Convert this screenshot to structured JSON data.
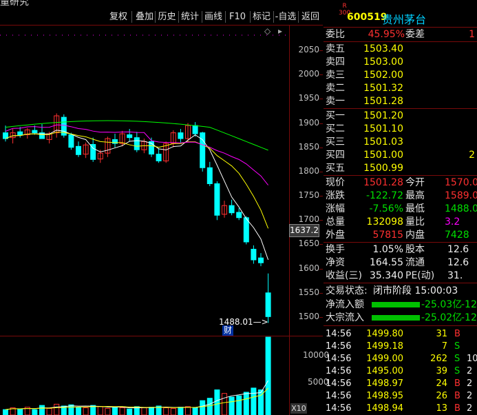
{
  "header": {
    "title_fragment": "量研究"
  },
  "toolbar": {
    "buttons": [
      "复权",
      "叠加",
      "历史",
      "统计",
      "画线",
      "F10",
      "标记",
      "-自选",
      "返回"
    ]
  },
  "chart": {
    "price_axis": [
      "2050",
      "2000",
      "1950",
      "1900",
      "1850",
      "1800",
      "1750",
      "1700",
      "1650",
      "1600",
      "1550",
      "1500"
    ],
    "current_price_tag": "1637.2",
    "low_annotation": "1488.01",
    "finance_marker": "财",
    "volume_axis": [
      "10000",
      "5000"
    ],
    "volume_unit": "X10",
    "colors": {
      "up": "#ff3030",
      "down": "#00ffff",
      "ma5": "#ffffff",
      "ma10": "#ffff00",
      "ma20": "#ff00ff",
      "ma60": "#00ff00"
    }
  },
  "chart_data": {
    "type": "candlestick",
    "candles": [
      {
        "o": 1880,
        "h": 1895,
        "l": 1862,
        "c": 1868
      },
      {
        "o": 1870,
        "h": 1888,
        "l": 1858,
        "c": 1880
      },
      {
        "o": 1882,
        "h": 1892,
        "l": 1870,
        "c": 1875
      },
      {
        "o": 1876,
        "h": 1890,
        "l": 1868,
        "c": 1886
      },
      {
        "o": 1885,
        "h": 1895,
        "l": 1876,
        "c": 1880
      },
      {
        "o": 1880,
        "h": 1898,
        "l": 1872,
        "c": 1868
      },
      {
        "o": 1866,
        "h": 1882,
        "l": 1858,
        "c": 1878
      },
      {
        "o": 1880,
        "h": 1920,
        "l": 1870,
        "c": 1915
      },
      {
        "o": 1912,
        "h": 1918,
        "l": 1870,
        "c": 1875
      },
      {
        "o": 1876,
        "h": 1880,
        "l": 1845,
        "c": 1850
      },
      {
        "o": 1852,
        "h": 1862,
        "l": 1830,
        "c": 1835
      },
      {
        "o": 1836,
        "h": 1860,
        "l": 1828,
        "c": 1855
      },
      {
        "o": 1856,
        "h": 1870,
        "l": 1820,
        "c": 1825
      },
      {
        "o": 1826,
        "h": 1845,
        "l": 1818,
        "c": 1838
      },
      {
        "o": 1838,
        "h": 1872,
        "l": 1830,
        "c": 1868
      },
      {
        "o": 1866,
        "h": 1878,
        "l": 1850,
        "c": 1858
      },
      {
        "o": 1858,
        "h": 1884,
        "l": 1852,
        "c": 1878
      },
      {
        "o": 1876,
        "h": 1888,
        "l": 1862,
        "c": 1870
      },
      {
        "o": 1870,
        "h": 1882,
        "l": 1840,
        "c": 1845
      },
      {
        "o": 1845,
        "h": 1868,
        "l": 1838,
        "c": 1862
      },
      {
        "o": 1862,
        "h": 1870,
        "l": 1830,
        "c": 1836
      },
      {
        "o": 1836,
        "h": 1848,
        "l": 1818,
        "c": 1822
      },
      {
        "o": 1822,
        "h": 1862,
        "l": 1818,
        "c": 1858
      },
      {
        "o": 1858,
        "h": 1885,
        "l": 1850,
        "c": 1880
      },
      {
        "o": 1880,
        "h": 1888,
        "l": 1860,
        "c": 1868
      },
      {
        "o": 1868,
        "h": 1900,
        "l": 1860,
        "c": 1895
      },
      {
        "o": 1895,
        "h": 1902,
        "l": 1872,
        "c": 1878
      },
      {
        "o": 1880,
        "h": 1882,
        "l": 1800,
        "c": 1808
      },
      {
        "o": 1808,
        "h": 1820,
        "l": 1770,
        "c": 1775
      },
      {
        "o": 1775,
        "h": 1780,
        "l": 1700,
        "c": 1710
      },
      {
        "o": 1712,
        "h": 1740,
        "l": 1705,
        "c": 1730
      },
      {
        "o": 1730,
        "h": 1742,
        "l": 1710,
        "c": 1715
      },
      {
        "o": 1716,
        "h": 1725,
        "l": 1700,
        "c": 1705
      },
      {
        "o": 1705,
        "h": 1708,
        "l": 1650,
        "c": 1655
      },
      {
        "o": 1640,
        "h": 1648,
        "l": 1610,
        "c": 1618
      },
      {
        "o": 1622,
        "h": 1632,
        "l": 1605,
        "c": 1612
      },
      {
        "o": 1550,
        "h": 1590,
        "l": 1488,
        "c": 1501
      }
    ],
    "volumes": [
      900,
      1200,
      1000,
      1300,
      900,
      1600,
      1100,
      1800,
      1500,
      1700,
      1300,
      1200,
      1600,
      1400,
      1100,
      1300,
      1200,
      1000,
      1400,
      1200,
      1300,
      1500,
      1200,
      1100,
      1300,
      1400,
      1200,
      2400,
      2800,
      4200,
      3600,
      3000,
      3200,
      3800,
      4500,
      4200,
      13000
    ]
  },
  "quote": {
    "code_badge_top": "R",
    "code_badge_bottom": "300",
    "code": "600519",
    "name": "贵州茅台",
    "weibi_label": "委比",
    "weibi_value": "45.95%",
    "weicha_label": "委差",
    "weicha_value": "1",
    "asks": [
      {
        "label": "卖五",
        "price": "1503.40"
      },
      {
        "label": "卖四",
        "price": "1503.00"
      },
      {
        "label": "卖三",
        "price": "1502.00"
      },
      {
        "label": "卖二",
        "price": "1501.32"
      },
      {
        "label": "卖一",
        "price": "1501.28"
      }
    ],
    "bids": [
      {
        "label": "买一",
        "price": "1501.20",
        "vol": ""
      },
      {
        "label": "买二",
        "price": "1501.10",
        "vol": ""
      },
      {
        "label": "买三",
        "price": "1501.03",
        "vol": ""
      },
      {
        "label": "买四",
        "price": "1501.00",
        "vol": "2"
      },
      {
        "label": "买五",
        "price": "1500.99",
        "vol": ""
      }
    ],
    "stats": [
      {
        "l1": "现价",
        "v1": "1501.28",
        "l2": "今开",
        "v2": "1570.0"
      },
      {
        "l1": "涨跌",
        "v1": "-122.72",
        "l2": "最高",
        "v2": "1589.0"
      },
      {
        "l1": "涨幅",
        "v1": "-7.56%",
        "l2": "最低",
        "v2": "1488.0"
      },
      {
        "l1": "总量",
        "v1": "132098",
        "l2": "量比",
        "v2": "3.2"
      },
      {
        "l1": "外盘",
        "v1": "57815",
        "l2": "内盘",
        "v2": "7428"
      }
    ],
    "stats2": [
      {
        "l1": "换手",
        "v1": "1.05%",
        "l2": "股本",
        "v2": "12.6"
      },
      {
        "l1": "净资",
        "v1": "164.55",
        "l2": "流通",
        "v2": "12.6"
      },
      {
        "l1": "收益(三)",
        "v1": "35.340",
        "l2": "PE(动)",
        "v2": "31."
      }
    ],
    "status_label": "交易状态:",
    "status_value": "闭市阶段 15:00:03",
    "flows": [
      {
        "label": "净流入额",
        "value": "-25.03亿",
        "extra": "-12"
      },
      {
        "label": "大宗流入",
        "value": "-25.02亿",
        "extra": "-12"
      }
    ],
    "ticks": [
      {
        "time": "14:56",
        "price": "1499.80",
        "vol": "31",
        "side": "B",
        "extra": ""
      },
      {
        "time": "14:56",
        "price": "1499.18",
        "vol": "7",
        "side": "S",
        "extra": ""
      },
      {
        "time": "14:56",
        "price": "1499.00",
        "vol": "262",
        "side": "S",
        "extra": "10"
      },
      {
        "time": "14:56",
        "price": "1495.00",
        "vol": "39",
        "side": "S",
        "extra": "2"
      },
      {
        "time": "14:56",
        "price": "1498.97",
        "vol": "24",
        "side": "B",
        "extra": "2"
      },
      {
        "time": "14:56",
        "price": "1498.95",
        "vol": "26",
        "side": "B",
        "extra": "2"
      },
      {
        "time": "14:56",
        "price": "1498.94",
        "vol": "13",
        "side": "B",
        "extra": "2"
      }
    ]
  }
}
